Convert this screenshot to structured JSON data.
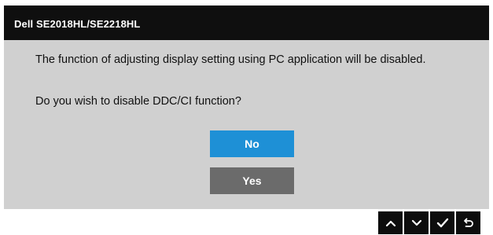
{
  "dialog": {
    "title": "Dell SE2018HL/SE2218HL",
    "message": "The function of adjusting display setting using PC application will be disabled.",
    "question": "Do you wish to disable DDC/CI function?",
    "buttons": {
      "no_label": "No",
      "yes_label": "Yes"
    }
  },
  "nav_bar": {
    "buttons": [
      {
        "icon": "chevron-up-icon"
      },
      {
        "icon": "chevron-down-icon"
      },
      {
        "icon": "checkmark-icon"
      },
      {
        "icon": "back-return-icon"
      }
    ]
  },
  "colors": {
    "title_bar": "#0f0f0f",
    "panel": "#d0d0d0",
    "selected_button": "#1e90d6",
    "unselected_button": "#6b6b6b",
    "nav_button": "#0d0d0d"
  }
}
